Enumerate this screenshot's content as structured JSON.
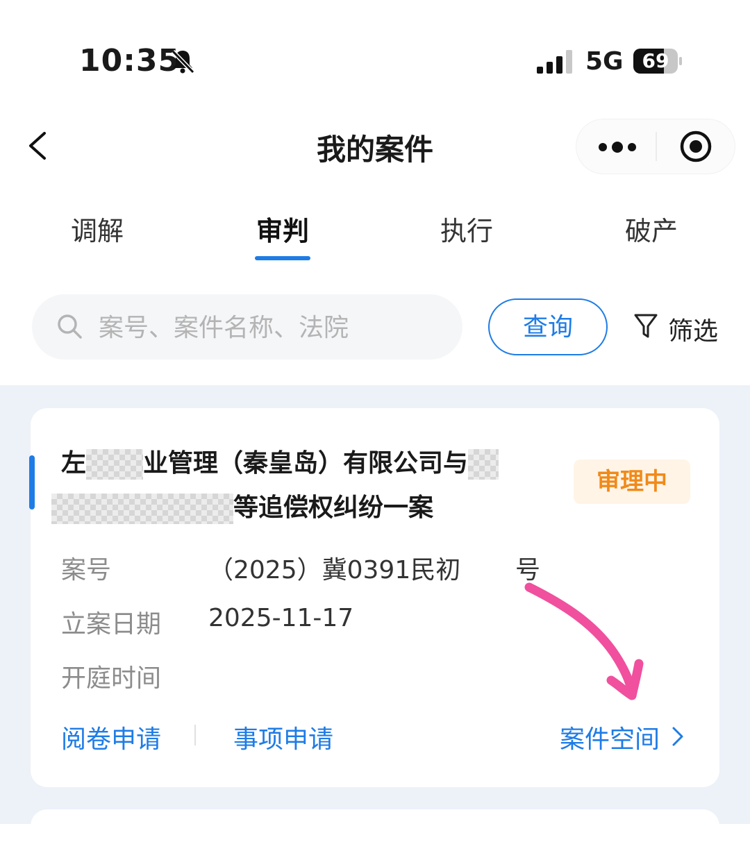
{
  "status_bar": {
    "time": "10:35",
    "network": "5G",
    "battery": "69",
    "battery_level": 0.69
  },
  "nav": {
    "title": "我的案件"
  },
  "tabs": [
    {
      "label": "调解",
      "active": false
    },
    {
      "label": "审判",
      "active": true
    },
    {
      "label": "执行",
      "active": false
    },
    {
      "label": "破产",
      "active": false
    }
  ],
  "search": {
    "placeholder": "案号、案件名称、法院",
    "query_label": "查询",
    "filter_label": "筛选"
  },
  "case": {
    "title_part1": "左",
    "title_part2": "业管理（秦皇岛）有限公司与",
    "title_part3": "等追偿权纠纷一案",
    "status": "审理中",
    "case_no_label": "案号",
    "case_no_prefix": "（2025）冀0391民初",
    "case_no_suffix": "号",
    "filing_date_label": "立案日期",
    "filing_date": "2025-11-17",
    "hearing_time_label": "开庭时间",
    "hearing_time": "",
    "actions": {
      "review": "阅卷申请",
      "matter": "事项申请",
      "space": "案件空间"
    }
  },
  "colors": {
    "accent": "#1e7ce6",
    "status_text": "#f08a1a",
    "status_bg": "#fff4e6",
    "annotation_arrow": "#f0509e"
  }
}
